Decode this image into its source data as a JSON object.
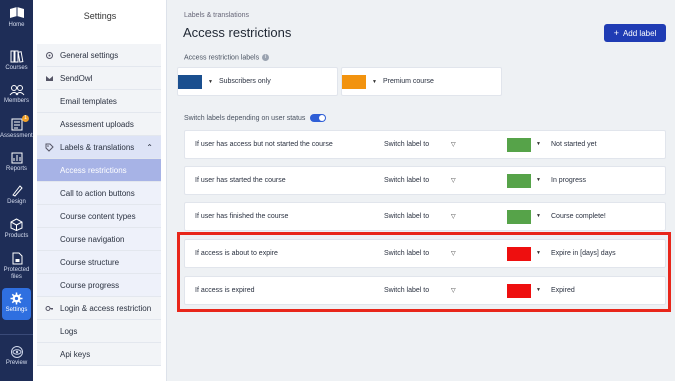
{
  "rail": {
    "items": [
      {
        "label": "Home",
        "icon": "home-icon"
      },
      {
        "label": "Courses",
        "icon": "courses-icon"
      },
      {
        "label": "Members",
        "icon": "members-icon"
      },
      {
        "label": "Assessments",
        "icon": "assessments-icon",
        "badge": "1"
      },
      {
        "label": "Reports",
        "icon": "reports-icon"
      },
      {
        "label": "Design",
        "icon": "design-icon"
      },
      {
        "label": "Products",
        "icon": "products-icon"
      },
      {
        "label": "Protected files",
        "icon": "protected-files-icon"
      },
      {
        "label": "Settings",
        "icon": "gear-icon"
      },
      {
        "label": "Preview",
        "icon": "eye-icon"
      }
    ]
  },
  "nav": {
    "title": "Settings",
    "items": [
      {
        "label": "General settings",
        "icon": "gear-icon"
      },
      {
        "label": "SendOwl",
        "icon": "sendowl-icon"
      },
      {
        "label": "Email templates"
      },
      {
        "label": "Assessment uploads"
      },
      {
        "label": "Labels & translations",
        "icon": "tag-icon"
      }
    ],
    "sub_items": [
      "Access restrictions",
      "Call to action buttons",
      "Course content types",
      "Course navigation",
      "Course structure",
      "Course progress"
    ],
    "after_items": [
      {
        "label": "Login & access restriction",
        "icon": "key-icon"
      },
      {
        "label": "Logs"
      },
      {
        "label": "Api keys"
      }
    ]
  },
  "header": {
    "breadcrumb": "Labels & translations",
    "title": "Access restrictions",
    "add_button": "Add label"
  },
  "labels_section": {
    "title": "Access restriction labels",
    "labels": [
      {
        "name": "Subscribers only",
        "color": "#1a4f8f"
      },
      {
        "name": "Premium course",
        "color": "#f2930f"
      }
    ]
  },
  "switch_section": {
    "title": "Switch labels depending on user status",
    "switch_text": "Switch label to",
    "rows": [
      {
        "condition": "If user has access but not started the course",
        "color": "#56a349",
        "label": "Not started yet"
      },
      {
        "condition": "If user has started the course",
        "color": "#56a349",
        "label": "In progress"
      },
      {
        "condition": "If user has finished the course",
        "color": "#56a349",
        "label": "Course complete!"
      },
      {
        "condition": "If access is about to expire",
        "color": "#ee0f0f",
        "label": "Expire in [days] days"
      },
      {
        "condition": "If access is expired",
        "color": "#ee0f0f",
        "label": "Expired"
      }
    ]
  },
  "colors": {
    "accent": "#1f3cb4",
    "rail": "#1e2d57",
    "highlight": "#e8261a"
  }
}
